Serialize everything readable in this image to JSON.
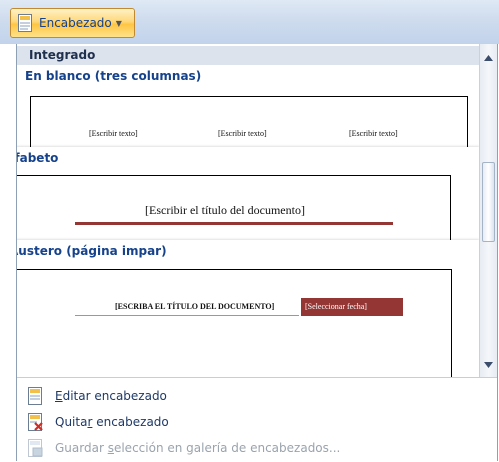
{
  "toolbar": {
    "button_label": "Encabezado",
    "button_icon": "header-doc-icon",
    "caret_icon": "dropdown-caret-icon"
  },
  "gallery": {
    "header": "Integrado",
    "templates": [
      {
        "title": "En blanco (tres columnas)",
        "placeholders": [
          "[Escribir texto]",
          "[Escribir texto]",
          "[Escribir texto]"
        ]
      },
      {
        "title": "Alfabeto",
        "placeholder": "[Escribir el título del documento]",
        "rule_color": "#943634"
      },
      {
        "title": "Austero (página impar)",
        "title_placeholder": "[ESCRIBA EL TÍTULO DEL DOCUMENTO]",
        "date_placeholder": "[Seleccionar fecha]",
        "date_fill": "#943634"
      }
    ]
  },
  "menu": {
    "edit": {
      "prefix": "",
      "mnemonic": "E",
      "suffix": "ditar encabezado",
      "icon": "edit-header-icon"
    },
    "remove": {
      "prefix": "Quita",
      "mnemonic": "r",
      "suffix": " encabezado",
      "icon": "remove-header-icon"
    },
    "save": {
      "prefix": "Guardar ",
      "mnemonic": "s",
      "suffix": "elección en galería de encabezados...",
      "icon": "save-to-gallery-icon",
      "disabled": true
    }
  },
  "colors": {
    "accent": "#943634",
    "label_blue": "#15428b",
    "button_highlight": "#ffd77a"
  }
}
